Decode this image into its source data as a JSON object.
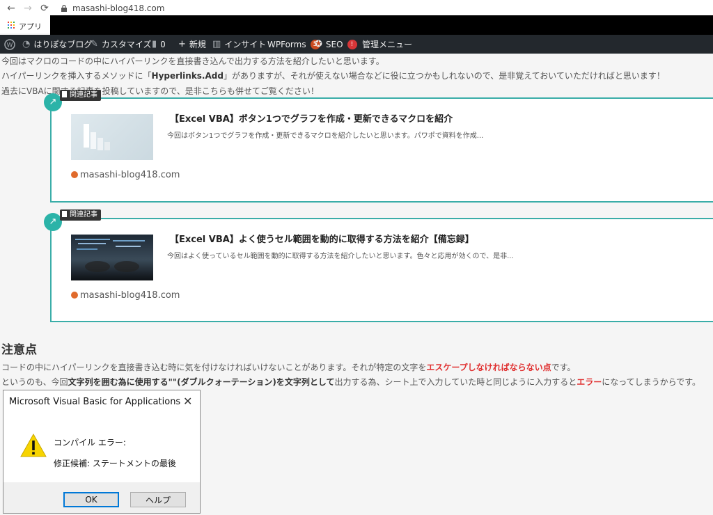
{
  "browser": {
    "back_icon": "←",
    "forward_icon": "→",
    "reload_icon": "⟳",
    "url": "masashi-blog418.com",
    "apps_label": "アプリ"
  },
  "admin_bar": {
    "wp_logo": "W",
    "site_name": "はりぽなブログ",
    "customize": "カスタマイズ",
    "comments_count": "0",
    "new_label": "新規",
    "insight": "インサイト",
    "wpforms": "WPForms",
    "wpforms_badge": "5",
    "seo": "SEO",
    "seo_badge": "!",
    "admin_menu": "管理メニュー"
  },
  "article": {
    "p1": "今回はマクロのコードの中にハイパーリンクを直接書き込んで出力する方法を紹介したいと思います。",
    "p2_a": "ハイパーリンクを挿入するメソッドに「",
    "p2_b": "Hyperlinks.Add",
    "p2_c": "」がありますが、それが使えない場合などに役に立つかもしれないので、是非覚えておいていただければと思います！",
    "p3": "過去にVBAに関する記事を投稿していますので、是非こちらも併せてご覧ください！",
    "cards": [
      {
        "tag": "関連記事",
        "title": "【Excel VBA】ボタン1つでグラフを作成・更新できるマクロを紹介",
        "desc": "今回はボタン1つでグラフを作成・更新できるマクロを紹介したいと思います。パワポで資料を作成...",
        "site": "masashi-blog418.com"
      },
      {
        "tag": "関連記事",
        "title": "【Excel VBA】よく使うセル範囲を動的に取得する方法を紹介【備忘録】",
        "desc": "今回はよく使っているセル範囲を動的に取得する方法を紹介したいと思います。色々と応用が効くので、是非...",
        "site": "masashi-blog418.com"
      }
    ],
    "heading": "注意点",
    "n1_a": "コードの中にハイパーリンクを直接書き込む時に気を付けなければいけないことがあります。それが特定の文字を",
    "n1_b": "エスケープしなければならない点",
    "n1_c": "です。",
    "n2_a": "というのも、今回",
    "n2_b": "文字列を囲む為に使用する\"\"(ダブルクォーテーション)を文字列として",
    "n2_c": "出力する為、シート上で入力していた時と同じように入力すると",
    "n2_d": "エラー",
    "n2_e": "になってしまうからです。"
  },
  "dialog": {
    "title": "Microsoft Visual Basic for Applications",
    "close_icon": "✕",
    "line1": "コンパイル エラー:",
    "line2": "修正候補: ステートメントの最後",
    "ok": "OK",
    "help": "ヘルプ"
  },
  "colors": {
    "accent": "#3aada8",
    "admin_bar": "#23282d",
    "emphasis": "#e03030"
  }
}
